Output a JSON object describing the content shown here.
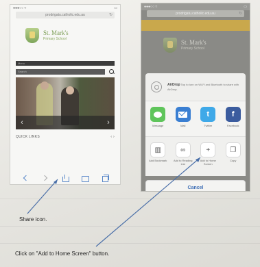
{
  "left_phone": {
    "status_left": "●●●○○ ≈",
    "status_right": "▭",
    "url": "prodrigatu.catholic.edu.au",
    "reload": "↻",
    "school_name_line1": "St. Mark's",
    "school_name_line2": "Primary School",
    "menu_label": "Menu",
    "search_placeholder": "Search",
    "quick_links_label": "QUICK LINKS",
    "quick_links_pager": "‹ ›",
    "photo_prev": "‹",
    "photo_next": "›"
  },
  "right_phone": {
    "status_left": "●●●○○ ≈",
    "status_right": "▭",
    "url": "prodrigatu.catholic.edu.au",
    "reload": "↻",
    "school_name_line1": "St. Mark's",
    "school_name_line2": "Primary School",
    "share_sheet": {
      "airdrop_title": "AirDrop",
      "airdrop_text": "Tap to turn on Wi-Fi and Bluetooth to share with AirDrop.",
      "apps": [
        {
          "label": "Message",
          "glyph": ""
        },
        {
          "label": "Mail",
          "glyph": ""
        },
        {
          "label": "Twitter",
          "glyph": "t"
        },
        {
          "label": "Facebook",
          "glyph": "f"
        }
      ],
      "actions": [
        {
          "label": "Add Bookmark",
          "glyph": "▥"
        },
        {
          "label": "Add to Reading List",
          "glyph": "∞"
        },
        {
          "label": "Add to Home Screen",
          "glyph": "+"
        },
        {
          "label": "Copy",
          "glyph": "❐"
        }
      ],
      "cancel_label": "Cancel"
    }
  },
  "captions": {
    "share_icon": "Share icon.",
    "home_screen": "Click on \"Add to Home Screen\" button."
  }
}
